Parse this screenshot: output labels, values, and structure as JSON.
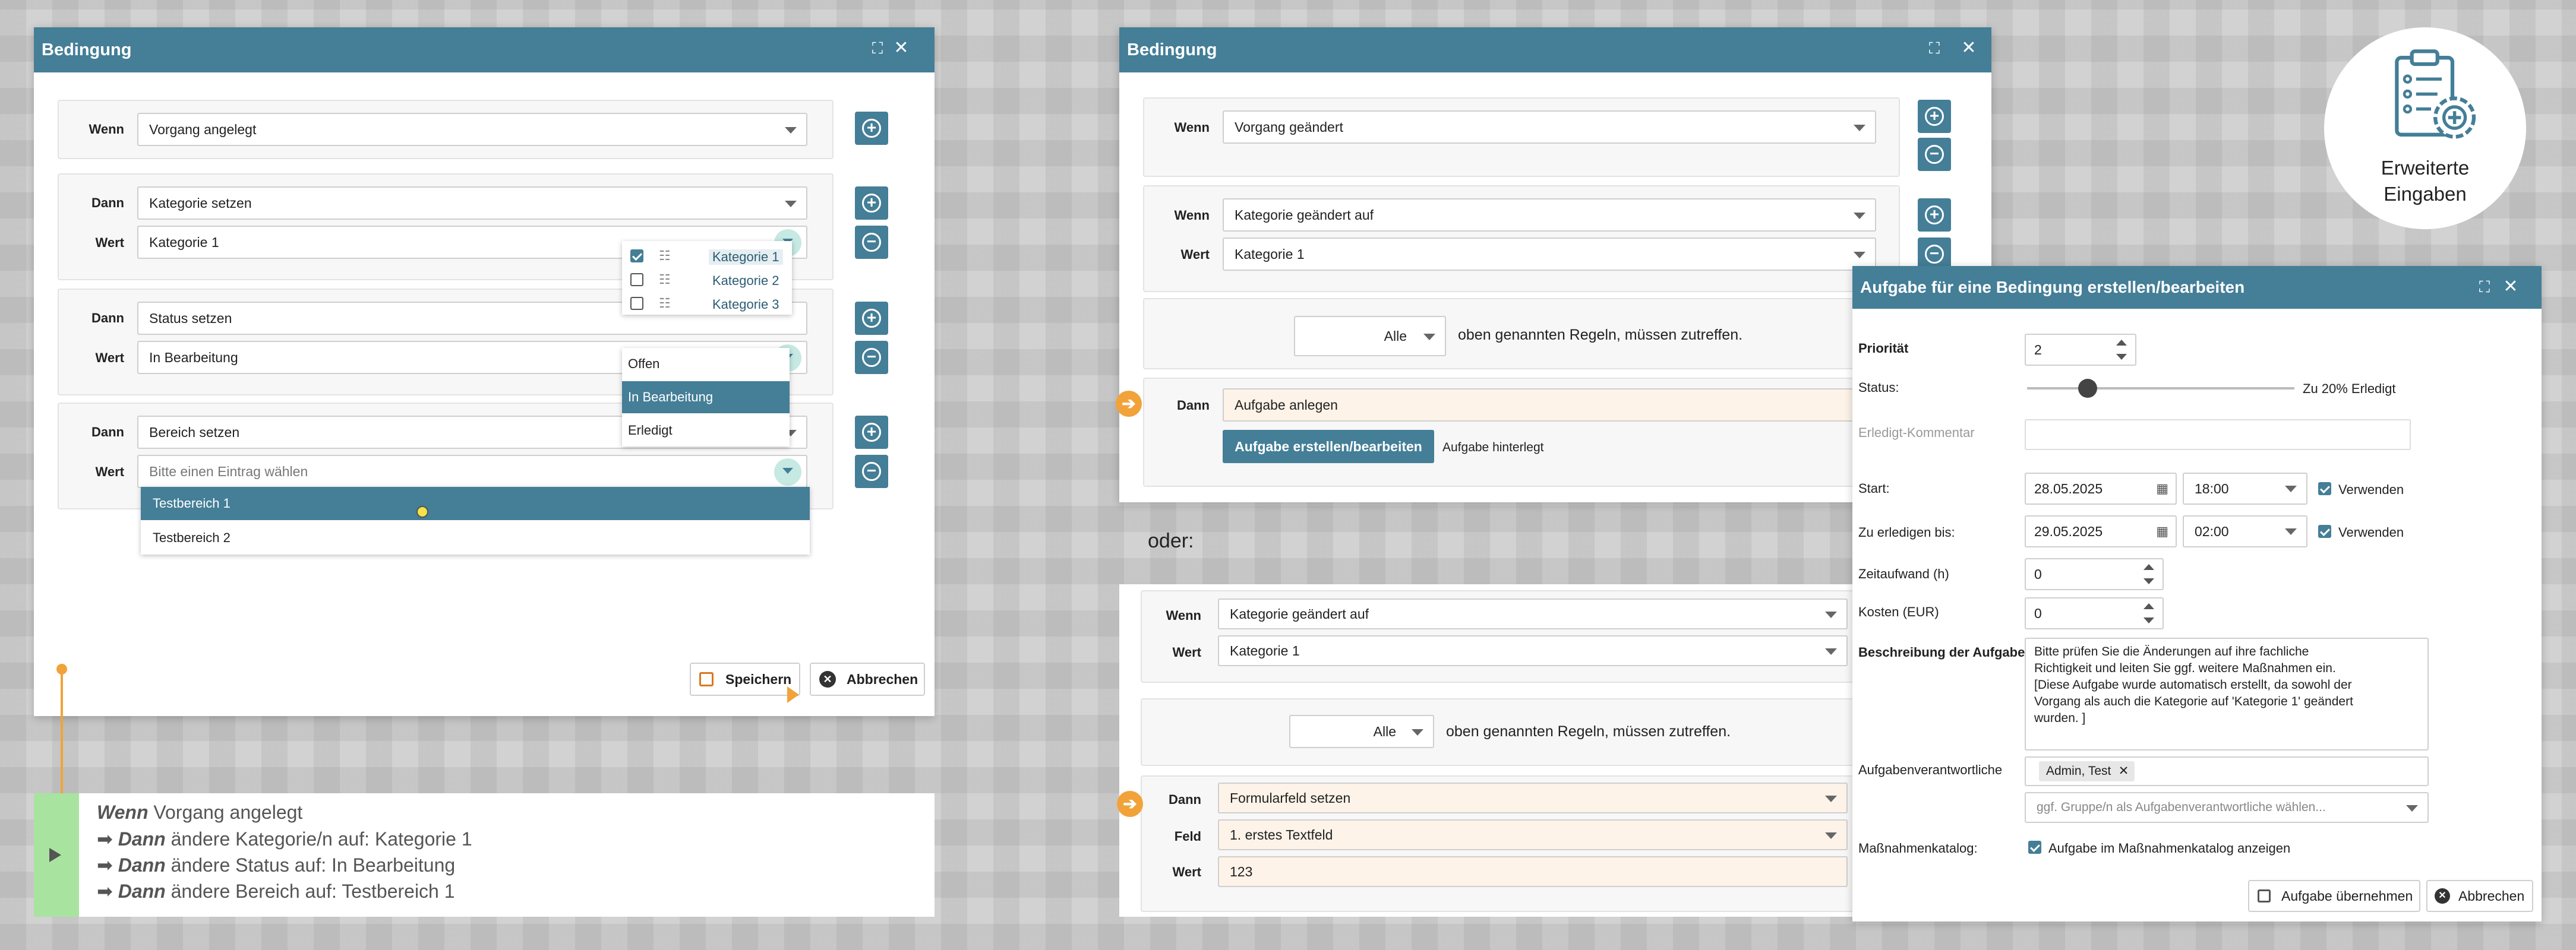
{
  "left_dialog": {
    "title": "Bedingung",
    "rows": [
      {
        "label1": "Wenn",
        "value1": "Vorgang angelegt"
      },
      {
        "label1": "Dann",
        "value1": "Kategorie setzen",
        "label2": "Wert",
        "value2": "Kategorie 1"
      },
      {
        "label1": "Dann",
        "value1": "Status setzen",
        "label2": "Wert",
        "value2": "In Bearbeitung"
      },
      {
        "label1": "Dann",
        "value1": "Bereich setzen",
        "label2": "Wert",
        "placeholder2": "Bitte einen Eintrag wählen"
      }
    ],
    "kategorie_menu": [
      "Kategorie 1",
      "Kategorie 2",
      "Kategorie 3"
    ],
    "status_menu": [
      "Offen",
      "In Bearbeitung",
      "Erledigt"
    ],
    "bereich_menu": [
      "Testbereich 1",
      "Testbereich 2"
    ],
    "save_label": "Speichern",
    "cancel_label": "Abbrechen"
  },
  "summary": {
    "lines": [
      {
        "kw": "Wenn",
        "text": " Vorgang angelegt"
      },
      {
        "arrow": "➡ ",
        "kw": "Dann",
        "text": " ändere Kategorie/n auf: Kategorie 1"
      },
      {
        "arrow": "➡ ",
        "kw": "Dann",
        "text": " ändere Status auf: In Bearbeitung"
      },
      {
        "arrow": "➡ ",
        "kw": "Dann",
        "text": " ändere Bereich auf: Testbereich 1"
      }
    ]
  },
  "right_dialog": {
    "title": "Bedingung",
    "row1": {
      "label": "Wenn",
      "value": "Vorgang geändert"
    },
    "row2": {
      "label1": "Wenn",
      "value1": "Kategorie geändert auf",
      "label2": "Wert",
      "value2": "Kategorie 1"
    },
    "rule1": {
      "select": "Alle",
      "text": "oben genannten Regeln, müssen zutreffen."
    },
    "action1": {
      "label": "Dann",
      "value": "Aufgabe anlegen",
      "button": "Aufgabe erstellen/bearbeiten",
      "note": "Aufgabe hinterlegt"
    },
    "oder": "oder:",
    "row3": {
      "label1": "Wenn",
      "value1": "Kategorie geändert auf",
      "label2": "Wert",
      "value2": "Kategorie 1"
    },
    "rule2": {
      "select": "Alle",
      "text": "oben genannten Regeln, müssen zutreffen."
    },
    "action2": {
      "label1": "Dann",
      "value1": "Formularfeld setzen",
      "label2": "Feld",
      "value2": "1. erstes Textfeld",
      "label3": "Wert",
      "value3": "123"
    }
  },
  "badge": {
    "line1": "Erweiterte",
    "line2": "Eingaben"
  },
  "task_dialog": {
    "title": "Aufgabe für eine Bedingung erstellen/bearbeiten",
    "priority_label": "Priorität",
    "priority": "2",
    "status_label": "Status:",
    "status_text": "Zu 20% Erledigt",
    "status_progress": 0.2,
    "comment_label": "Erledigt-Kommentar",
    "start_label": "Start:",
    "start_date": "28.05.2025",
    "start_time": "18:00",
    "start_use": "Verwenden",
    "due_label": "Zu erledigen bis:",
    "due_date": "29.05.2025",
    "due_time": "02:00",
    "due_use": "Verwenden",
    "effort_label": "Zeitaufwand (h)",
    "effort": "0",
    "cost_label": "Kosten (EUR)",
    "cost": "0",
    "desc_label": "Beschreibung der Aufgabe",
    "desc_lines": [
      "Bitte prüfen Sie die Änderungen auf ihre fachliche",
      "Richtigkeit und leiten Sie ggf. weitere Maßnahmen ein.",
      "[Diese Aufgabe wurde automatisch erstellt, da sowohl der",
      "Vorgang als auch die Kategorie auf 'Kategorie 1' geändert",
      "wurden. ]"
    ],
    "resp_label": "Aufgabenverantwortliche",
    "resp_tag": "Admin, Test",
    "group_placeholder": "ggf. Gruppe/n als Aufgabenverantwortliche wählen...",
    "catalog_label": "Maßnahmenkatalog:",
    "catalog_text": "Aufgabe im Maßnahmenkatalog anzeigen",
    "accept_label": "Aufgabe übernehmen",
    "cancel_label": "Abbrechen"
  },
  "colors": {
    "header": "#447e97",
    "accent_orange": "#f1a33a",
    "summary_green": "#a8e4a0"
  }
}
